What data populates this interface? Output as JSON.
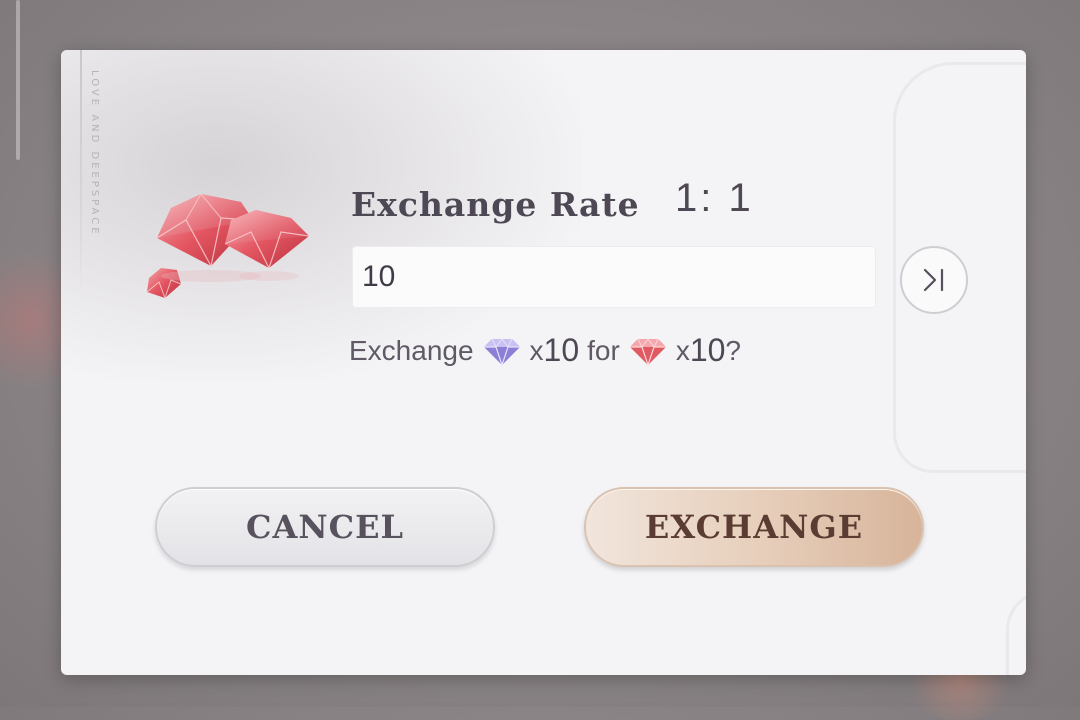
{
  "dialog": {
    "side_text": "LOVE AND DEEPSPACE",
    "rate_label": "Exchange Rate",
    "rate_value": "1: 1",
    "amount_value": "10",
    "confirm": {
      "prefix": "Exchange",
      "from_currency_icon": "purple-gem-icon",
      "from_qty_x": "x",
      "from_qty_num": "10",
      "middle": "for",
      "to_currency_icon": "red-gem-icon",
      "to_qty_x": "x",
      "to_qty_num": "10",
      "suffix": "?"
    },
    "cancel_label": "CANCEL",
    "exchange_label": "EXCHANGE",
    "max_icon": "skip-to-max-icon"
  },
  "colors": {
    "red_gem": "#e05a62",
    "purple_gem": "#8c7fd6",
    "exchange_button": "#e6cdb9",
    "cancel_button": "#e9e8ec",
    "text": "#4d4854"
  }
}
